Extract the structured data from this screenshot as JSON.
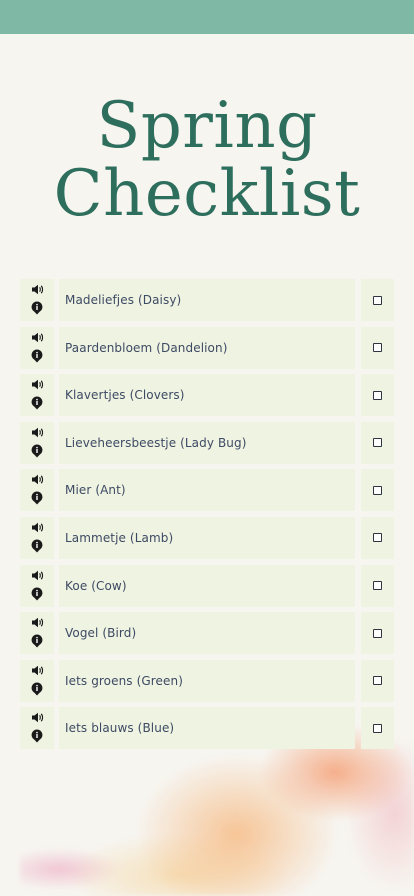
{
  "title": {
    "line1": "Spring",
    "line2": "Checklist"
  },
  "colors": {
    "topbar": "#7fb8a4",
    "title": "#2e6e5d",
    "cell_bg": "#eff3e2",
    "label_text": "#3d4a63"
  },
  "icons": {
    "sound": "speaker-icon",
    "info": "info-pin-icon"
  },
  "items": [
    {
      "label": "Madeliefjes (Daisy)",
      "checked": false
    },
    {
      "label": "Paardenbloem (Dandelion)",
      "checked": false
    },
    {
      "label": "Klavertjes (Clovers)",
      "checked": false
    },
    {
      "label": "Lieveheersbeestje (Lady Bug)",
      "checked": false
    },
    {
      "label": "Mier (Ant)",
      "checked": false
    },
    {
      "label": "Lammetje (Lamb)",
      "checked": false
    },
    {
      "label": "Koe (Cow)",
      "checked": false
    },
    {
      "label": "Vogel (Bird)",
      "checked": false
    },
    {
      "label": "Iets groens (Green)",
      "checked": false
    },
    {
      "label": "Iets blauws (Blue)",
      "checked": false
    }
  ]
}
